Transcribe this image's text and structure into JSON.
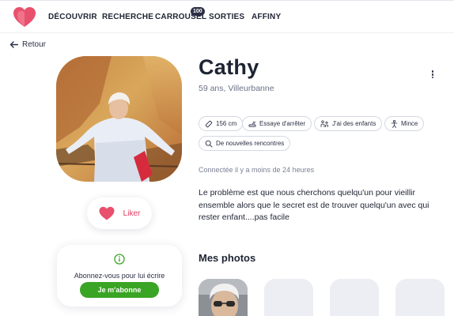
{
  "nav": {
    "items": [
      {
        "key": "decouvrir",
        "label": "DÉCOUVRIR"
      },
      {
        "key": "recherche",
        "label": "RECHERCHE"
      },
      {
        "key": "carrousel",
        "label": "CARROUSEL"
      },
      {
        "key": "sorties",
        "label": "SORTIES"
      },
      {
        "key": "affiny",
        "label": "AFFINY"
      }
    ],
    "carrousel_badge": "100"
  },
  "back": {
    "label": "Retour"
  },
  "profile": {
    "name": "Cathy",
    "meta": "59 ans, Villeurbanne",
    "chips": [
      {
        "icon": "ruler-icon",
        "label": "156 cm"
      },
      {
        "icon": "smoking-icon",
        "label": "Essaye d'arrêter"
      },
      {
        "icon": "family-icon",
        "label": "J'ai des enfants"
      },
      {
        "icon": "person-icon",
        "label": "Mince"
      },
      {
        "icon": "search-icon",
        "label": "De nouvelles rencontres"
      }
    ],
    "last_seen": "Connectée il y a moins de 24 heures",
    "bio": "Le problème est que nous cherchons quelqu'un pour vieillir ensemble alors que le secret est de trouver quelqu'un avec qui rester enfant....pas facile"
  },
  "like": {
    "label": "Liker"
  },
  "subscribe": {
    "text": "Abonnez-vous pour lui écrire",
    "button": "Je m'abonne"
  },
  "photos": {
    "title": "Mes photos"
  },
  "colors": {
    "accent": "#e03a5d",
    "subscribe_green": "#3aa524",
    "text_dark": "#1f2433"
  }
}
